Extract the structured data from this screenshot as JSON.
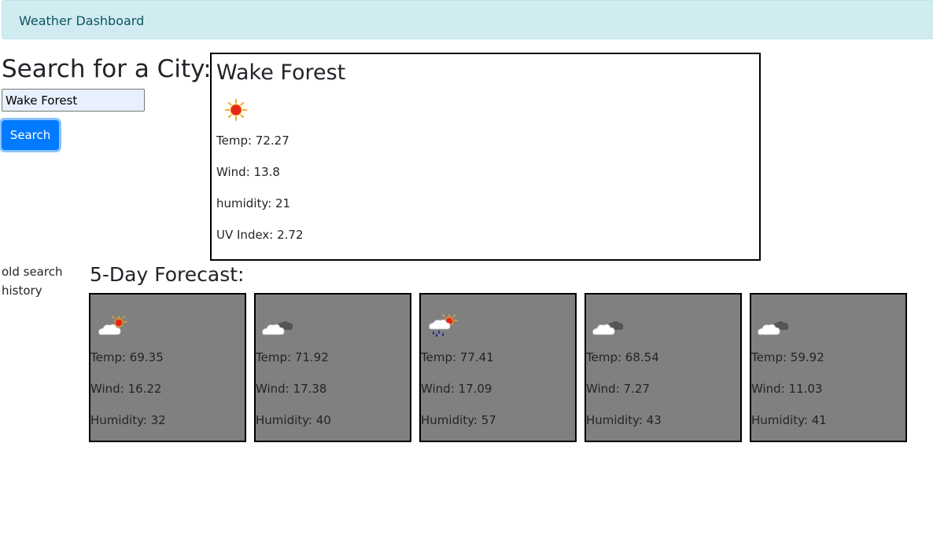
{
  "header": {
    "title": "Weather Dashboard"
  },
  "search": {
    "heading": "Search for a City:",
    "input_value": "Wake Forest",
    "button_label": "Search"
  },
  "current": {
    "city": "Wake Forest",
    "icon": "sunny-icon",
    "temp": "Temp: 72.27",
    "wind": "Wind: 13.8",
    "humidity": "humidity: 21",
    "uv": "UV Index: 2.72"
  },
  "history": {
    "label": "old search history"
  },
  "forecast": {
    "heading": "5-Day Forecast:",
    "days": [
      {
        "icon": "partly-cloudy-sun-icon",
        "temp": "Temp: 69.35",
        "wind": "Wind: 16.22",
        "humidity": "Humidity: 32"
      },
      {
        "icon": "cloudy-icon",
        "temp": "Temp: 71.92",
        "wind": "Wind: 17.38",
        "humidity": "Humidity: 40"
      },
      {
        "icon": "rain-sun-icon",
        "temp": "Temp: 77.41",
        "wind": "Wind: 17.09",
        "humidity": "Humidity: 57"
      },
      {
        "icon": "cloudy-icon",
        "temp": "Temp: 68.54",
        "wind": "Wind: 7.27",
        "humidity": "Humidity: 43"
      },
      {
        "icon": "cloudy-icon",
        "temp": "Temp: 59.92",
        "wind": "Wind: 11.03",
        "humidity": "Humidity: 41"
      }
    ]
  },
  "colors": {
    "navbar_bg": "#d1ecf1",
    "navbar_text": "#0c5460",
    "button_primary": "#007bff",
    "card_bg": "#808080"
  }
}
